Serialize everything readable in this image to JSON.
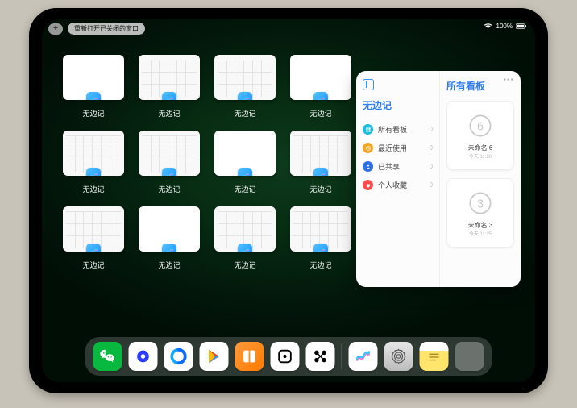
{
  "status": {
    "battery": "100%"
  },
  "topbar": {
    "plus": "+",
    "reopen": "重新打开已关闭的窗口"
  },
  "appswitcher": {
    "app_name": "无边记",
    "windows": [
      {
        "style": "blank"
      },
      {
        "style": "grid"
      },
      {
        "style": "grid"
      },
      {
        "style": "blank"
      },
      {
        "style": "grid"
      },
      {
        "style": "grid"
      },
      {
        "style": "blank"
      },
      {
        "style": "grid"
      },
      {
        "style": "grid"
      },
      {
        "style": "blank"
      },
      {
        "style": "grid"
      },
      {
        "style": "grid"
      }
    ]
  },
  "floatwin": {
    "left_title": "无边记",
    "right_title": "所有看板",
    "items": [
      {
        "icon": "grid",
        "color": "#1bbde0",
        "label": "所有看板",
        "count": 0
      },
      {
        "icon": "clock",
        "color": "#f5a623",
        "label": "最近使用",
        "count": 0
      },
      {
        "icon": "share",
        "color": "#2f6fe8",
        "label": "已共享",
        "count": 0
      },
      {
        "icon": "heart",
        "color": "#ff4d4d",
        "label": "个人收藏",
        "count": 0
      }
    ],
    "boards": [
      {
        "sketch": "6",
        "name": "未命名 6",
        "time": "今天 11:26"
      },
      {
        "sketch": "3",
        "name": "未命名 3",
        "time": "今天 11:25"
      }
    ]
  },
  "dock": {
    "apps": [
      {
        "name": "wechat",
        "bg": "#09b83e"
      },
      {
        "name": "quark",
        "bg": "#ffffff"
      },
      {
        "name": "qqbrowser",
        "bg": "#ffffff"
      },
      {
        "name": "playstore",
        "bg": "#ffffff"
      },
      {
        "name": "books",
        "bg": "linear-gradient(135deg,#ff9a3c,#ff7a00)"
      },
      {
        "name": "dice",
        "bg": "#ffffff"
      },
      {
        "name": "connect",
        "bg": "#ffffff"
      }
    ],
    "recent": [
      {
        "name": "freeform",
        "bg": "#ffffff"
      },
      {
        "name": "settings",
        "bg": "linear-gradient(#e6e6e6,#bcbcbc)"
      },
      {
        "name": "notes",
        "bg": "linear-gradient(#fff 0 30%,#ffe56b 30% 100%)"
      },
      {
        "name": "folder",
        "bg": ""
      }
    ]
  }
}
